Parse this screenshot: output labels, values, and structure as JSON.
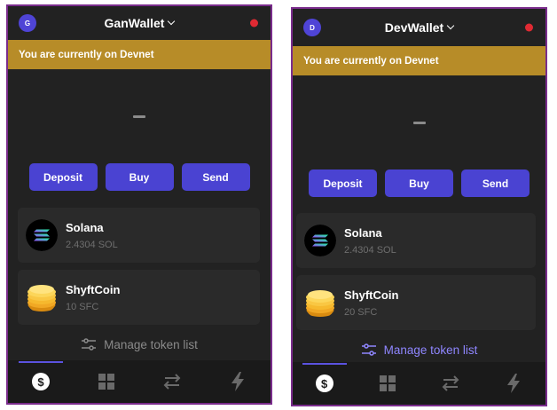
{
  "wallets": [
    {
      "avatar_letter": "G",
      "name": "GanWallet",
      "banner": "You are currently on Devnet",
      "balance": "–",
      "actions": [
        "Deposit",
        "Buy",
        "Send"
      ],
      "tokens": [
        {
          "name": "Solana",
          "amount": "2.4304 SOL",
          "icon": "solana-logo"
        },
        {
          "name": "ShyftCoin",
          "amount": "10 SFC",
          "icon": "shyftcoin-logo"
        }
      ],
      "manage_label": "Manage token list",
      "nav": [
        "dollar-icon",
        "grid-icon",
        "swap-icon",
        "lightning-icon"
      ]
    },
    {
      "avatar_letter": "D",
      "name": "DevWallet",
      "banner": "You are currently on Devnet",
      "balance": "–",
      "actions": [
        "Deposit",
        "Buy",
        "Send"
      ],
      "tokens": [
        {
          "name": "Solana",
          "amount": "2.4304 SOL",
          "icon": "solana-logo"
        },
        {
          "name": "ShyftCoin",
          "amount": "20 SFC",
          "icon": "shyftcoin-logo"
        }
      ],
      "manage_label": "Manage token list",
      "nav": [
        "dollar-icon",
        "grid-icon",
        "swap-icon",
        "lightning-icon"
      ]
    }
  ],
  "colors": {
    "panel": "#222222",
    "border": "#7a2c8c",
    "banner": "#b78c28",
    "button": "#4a43d2",
    "status": "#e02a33",
    "accent": "#8f86ff"
  }
}
